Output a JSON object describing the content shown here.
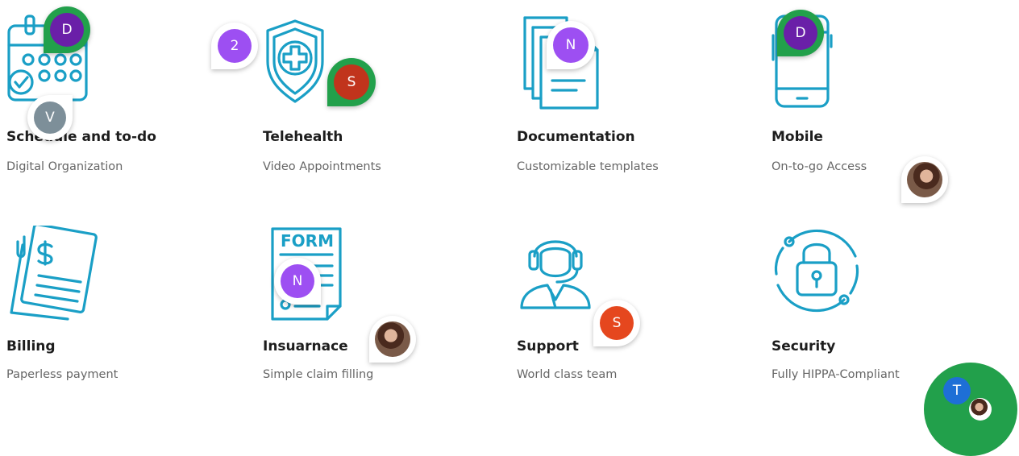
{
  "features": [
    {
      "title": "Schedule and to-do",
      "subtitle": "Digital Organization",
      "icon": "calendar-icon"
    },
    {
      "title": "Telehealth",
      "subtitle": "Video Appointments",
      "icon": "shield-plus-icon"
    },
    {
      "title": "Documentation",
      "subtitle": "Customizable templates",
      "icon": "documents-icon"
    },
    {
      "title": "Mobile",
      "subtitle": "On-to-go Access",
      "icon": "smartphone-icon"
    },
    {
      "title": "Billing",
      "subtitle": "Paperless payment",
      "icon": "invoice-dollar-icon"
    },
    {
      "title": "Insuarnace",
      "subtitle": "Simple claim filling",
      "icon": "form-icon"
    },
    {
      "title": "Support",
      "subtitle": "World class team",
      "icon": "headset-agent-icon"
    },
    {
      "title": "Security",
      "subtitle": "Fully HIPPA-Compliant",
      "icon": "padlock-icon"
    }
  ],
  "presence": {
    "d1": {
      "initial": "D",
      "color": "#6a1fa8",
      "ring": "#22a04b"
    },
    "v": {
      "initial": "V",
      "color": "#7d8f99"
    },
    "count": {
      "text": "2",
      "color": "#9d4ff2"
    },
    "s1": {
      "initial": "S",
      "color": "#c1341c",
      "ring": "#22a04b"
    },
    "n1": {
      "initial": "N",
      "color": "#9d4ff2"
    },
    "d2": {
      "initial": "D",
      "color": "#6a1fa8",
      "ring": "#22a04b"
    },
    "n2": {
      "initial": "N",
      "color": "#9d4ff2"
    },
    "s2": {
      "initial": "S",
      "color": "#e5471e"
    },
    "t": {
      "initial": "T",
      "color": "#1e6fd6",
      "ring": "#22a04b"
    }
  },
  "colors": {
    "icon": "#1a9fc6",
    "title": "#1d1d1d",
    "subtitle": "#666666"
  }
}
